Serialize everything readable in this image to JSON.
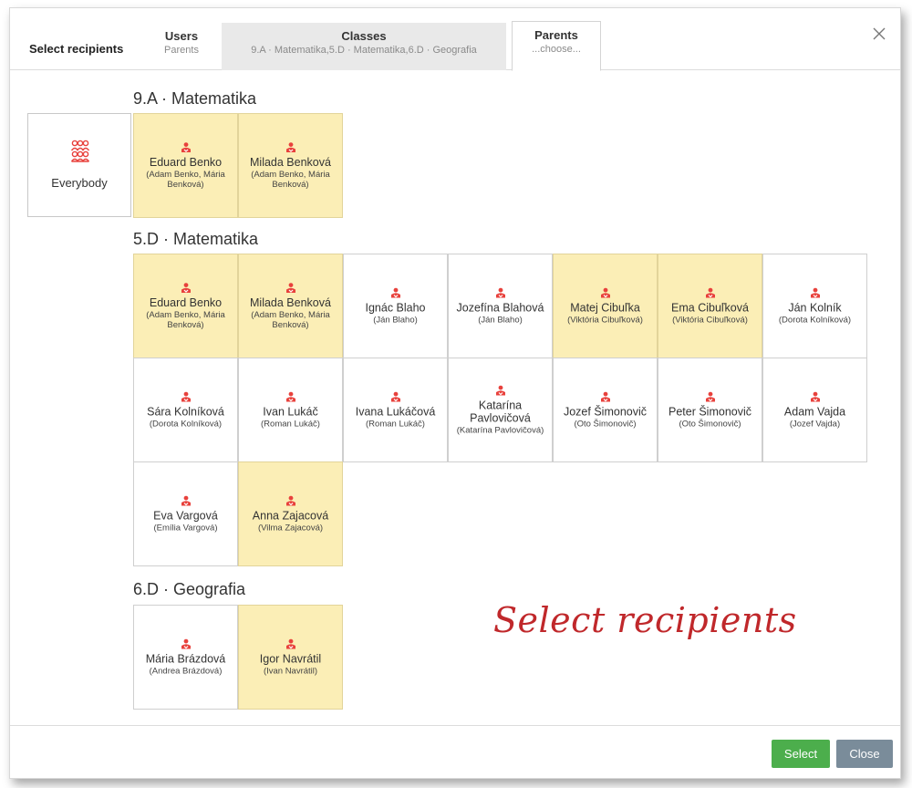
{
  "dialog": {
    "title": "Select recipients"
  },
  "tabs": [
    {
      "title": "Users",
      "subtitle": "Parents"
    },
    {
      "title": "Classes",
      "subtitle": "9.A · Matematika,5.D · Matematika,6.D · Geografia"
    },
    {
      "title": "Parents",
      "subtitle": "...choose..."
    }
  ],
  "everybody_label": "Everybody",
  "sections": [
    {
      "title": "9.A · Matematika"
    },
    {
      "title": "5.D · Matematika"
    },
    {
      "title": "6.D · Geografia"
    }
  ],
  "cards": {
    "s1": [
      {
        "name": "Eduard Benko",
        "parents": "(Adam Benko, Mária Benková)",
        "selected": true
      },
      {
        "name": "Milada Benková",
        "parents": "(Adam Benko, Mária Benková)",
        "selected": true
      }
    ],
    "s2": [
      {
        "name": "Eduard Benko",
        "parents": "(Adam Benko, Mária Benková)",
        "selected": true
      },
      {
        "name": "Milada Benková",
        "parents": "(Adam Benko, Mária Benková)",
        "selected": true
      },
      {
        "name": "Ignác Blaho",
        "parents": "(Ján Blaho)",
        "selected": false
      },
      {
        "name": "Jozefína Blahová",
        "parents": "(Ján Blaho)",
        "selected": false
      },
      {
        "name": "Matej Cibuľka",
        "parents": "(Viktória Cibuľková)",
        "selected": true
      },
      {
        "name": "Ema Cibuľková",
        "parents": "(Viktória Cibuľková)",
        "selected": true
      },
      {
        "name": "Ján Kolník",
        "parents": "(Dorota Kolníková)",
        "selected": false
      },
      {
        "name": "Sára Kolníková",
        "parents": "(Dorota Kolníková)",
        "selected": false
      },
      {
        "name": "Ivan Lukáč",
        "parents": "(Roman Lukáč)",
        "selected": false
      },
      {
        "name": "Ivana Lukáčová",
        "parents": "(Roman Lukáč)",
        "selected": false
      },
      {
        "name": "Katarína Pavlovičová",
        "parents": "(Katarína Pavlovičová)",
        "selected": false
      },
      {
        "name": "Jozef Šimonovič",
        "parents": "(Oto Šimonovič)",
        "selected": false
      },
      {
        "name": "Peter Šimonovič",
        "parents": "(Oto Šimonovič)",
        "selected": false
      },
      {
        "name": "Adam Vajda",
        "parents": "(Jozef Vajda)",
        "selected": false
      },
      {
        "name": "Eva Vargová",
        "parents": "(Emília Vargová)",
        "selected": false
      },
      {
        "name": "Anna Zajacová",
        "parents": "(Vilma Zajacová)",
        "selected": true
      }
    ],
    "s3": [
      {
        "name": "Mária Brázdová",
        "parents": "(Andrea Brázdová)",
        "selected": false
      },
      {
        "name": "Igor Navrátil",
        "parents": "(Ivan Navrátil)",
        "selected": true
      }
    ]
  },
  "annotation": "Select recipients",
  "footer": {
    "select_label": "Select",
    "close_label": "Close"
  },
  "colors": {
    "selected_bg": "#fbeeb6",
    "icon_red": "#e8413c",
    "select_green": "#4cae4c",
    "close_gray": "#7a8c9a"
  },
  "icons": {
    "student": "student-download-icon",
    "group": "group-people-icon",
    "close": "close-icon"
  }
}
